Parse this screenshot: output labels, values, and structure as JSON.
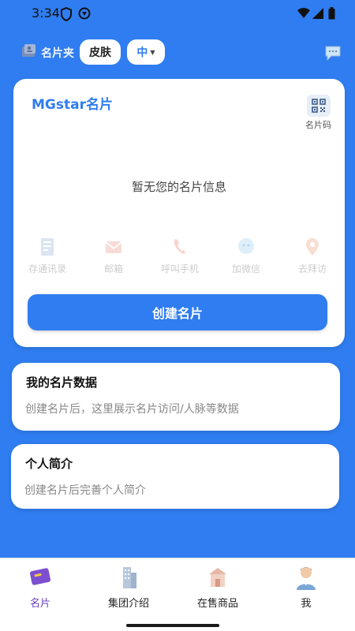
{
  "status": {
    "time": "3:34",
    "icons": [
      "shield-icon",
      "vpn-icon",
      "wifi-icon",
      "signal-icon",
      "battery-icon"
    ]
  },
  "topbar": {
    "folder_label": "名片夹",
    "skin_label": "皮肤",
    "language_label": "中"
  },
  "card": {
    "title": "MGstar名片",
    "qr_label": "名片码",
    "empty_message": "暂无您的名片信息",
    "actions": [
      {
        "label": "存通讯录",
        "icon": "address-book-icon"
      },
      {
        "label": "邮箱",
        "icon": "mail-icon"
      },
      {
        "label": "呼叫手机",
        "icon": "phone-icon"
      },
      {
        "label": "加微信",
        "icon": "wechat-icon"
      },
      {
        "label": "去拜访",
        "icon": "location-pin-icon"
      }
    ],
    "create_button": "创建名片"
  },
  "data_section": {
    "title": "我的名片数据",
    "description": "创建名片后，这里展示名片访问/人脉等数据"
  },
  "bio_section": {
    "title": "个人简介",
    "description": "创建名片后完善个人简介"
  },
  "bottom_nav": {
    "items": [
      {
        "label": "名片",
        "icon": "card-icon",
        "active": true
      },
      {
        "label": "集团介绍",
        "icon": "building-icon",
        "active": false
      },
      {
        "label": "在售商品",
        "icon": "shop-icon",
        "active": false
      },
      {
        "label": "我",
        "icon": "avatar-icon",
        "active": false
      }
    ]
  },
  "colors": {
    "primary": "#2f7df0",
    "active_nav": "#6a3fbf"
  }
}
